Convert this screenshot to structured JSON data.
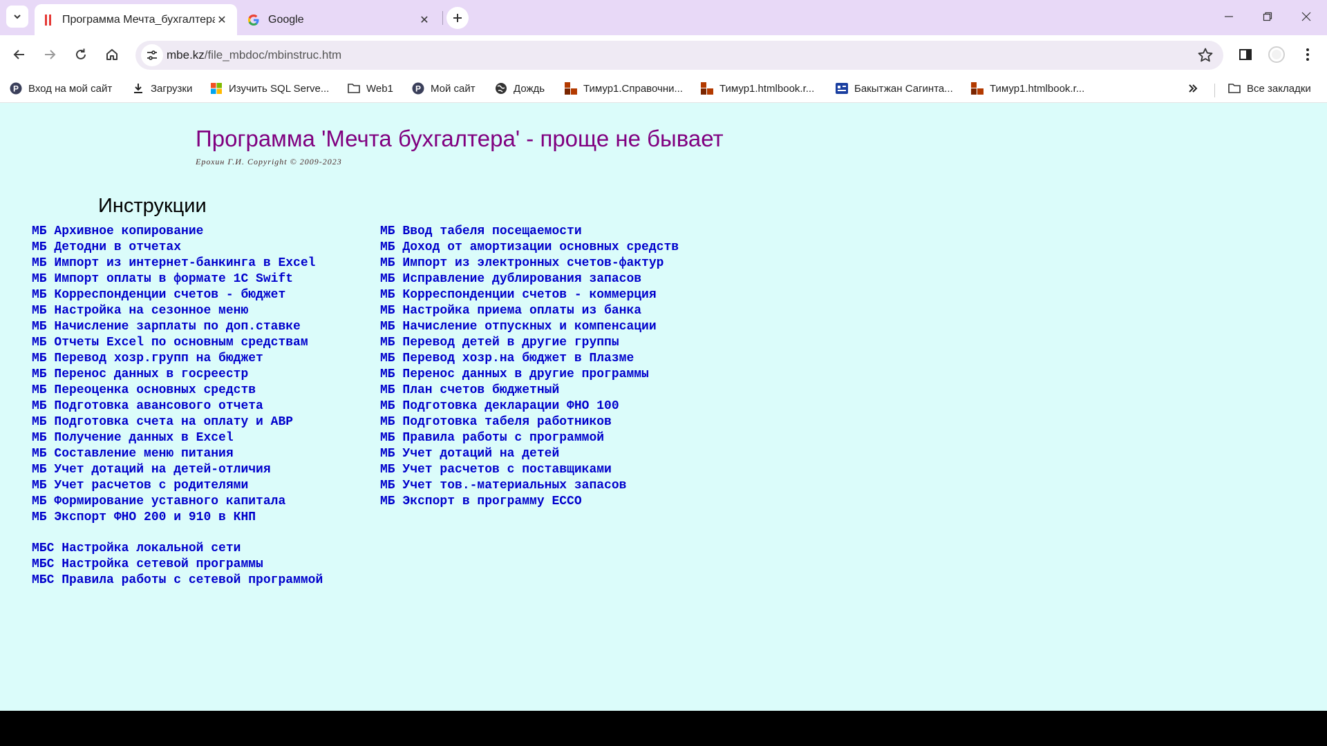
{
  "browser": {
    "tabs": [
      {
        "title": "Программа Мечта_бухгалтера",
        "active": true
      },
      {
        "title": "Google",
        "active": false
      }
    ],
    "url_domain": "mbe.kz",
    "url_path": "/file_mbdoc/mbinstruc.htm",
    "bookmarks": [
      {
        "label": "Вход на мой сайт",
        "icon": "p-circle-icon"
      },
      {
        "label": "Загрузки",
        "icon": "download-icon"
      },
      {
        "label": "Изучить SQL Serve...",
        "icon": "windows-logo-icon"
      },
      {
        "label": "Web1",
        "icon": "folder-icon"
      },
      {
        "label": "Мой сайт",
        "icon": "p-circle-icon"
      },
      {
        "label": "Дождь",
        "icon": "globe-icon"
      },
      {
        "label": "Тимур1.Справочни...",
        "icon": "htmlbook-icon"
      },
      {
        "label": "Тимур1.htmlbook.r...",
        "icon": "htmlbook-icon"
      },
      {
        "label": "Бакытжан Сагинта...",
        "icon": "profile-card-icon"
      },
      {
        "label": "Тимур1.htmlbook.r...",
        "icon": "htmlbook-icon"
      }
    ],
    "all_bookmarks": "Все закладки",
    "accent_color": "#e8d9f7"
  },
  "page": {
    "title": "Программа 'Мечта бухгалтера' - проще не бывает",
    "copyright": "Ерохин Г.И. Copyright © 2009-2023",
    "section_title": "Инструкции",
    "left_links": [
      "МБ Архивное копирование",
      "МБ Детодни в отчетах",
      "МБ Импорт из интернет-банкинга в Excel",
      "МБ Импорт оплаты в формате 1C Swift",
      "МБ Корреспонденции счетов - бюджет",
      "МБ Настройка на сезонное меню",
      "МБ Начисление зарплаты по доп.ставке",
      "МБ Отчеты Excel по основным средствам",
      "МБ Перевод хозр.групп на бюджет",
      "МБ Перенос данных в госреестр",
      "МБ Переоценка основных средств",
      "МБ Подготовка авансового отчета",
      "МБ Подготовка счета на оплату и АВР",
      "МБ Получение данных в Excel",
      "МБ Составление меню питания",
      "МБ Учет дотаций на детей-отличия",
      "МБ Учет расчетов с родителями",
      "МБ Формирование уставного капитала",
      "МБ Экспорт ФНО 200 и 910 в КНП"
    ],
    "right_links": [
      "МБ Ввод табеля посещаемости",
      "МБ Доход от амортизации основных средств",
      "МБ Импорт из электронных счетов-фактур",
      "МБ Исправление дублирования запасов",
      "МБ Корреспонденции счетов - коммерция",
      "МБ Настройка приема оплаты из банка",
      "МБ Начисление отпускных и компенсации",
      "МБ Перевод детей в другие группы",
      "МБ Перевод хозр.на бюджет в Плазме",
      "МБ Перенос данных в другие программы",
      "МБ План счетов бюджетный",
      "МБ Подготовка декларации ФНО 100",
      "МБ Подготовка табеля работников",
      "МБ Правила работы с программой",
      "МБ Учет дотаций на детей",
      "МБ Учет расчетов с поставщиками",
      "МБ Учет тов.-материальных запасов",
      "МБ Экспорт в программу ЕССО"
    ],
    "mbs_links": [
      "МБС Настройка локальной сети",
      "МБС Настройка сетевой программы",
      "МБС Правила работы с сетевой программой"
    ],
    "background_color": "#dbfcfa",
    "title_color": "#800080",
    "link_color": "#0000cc"
  }
}
